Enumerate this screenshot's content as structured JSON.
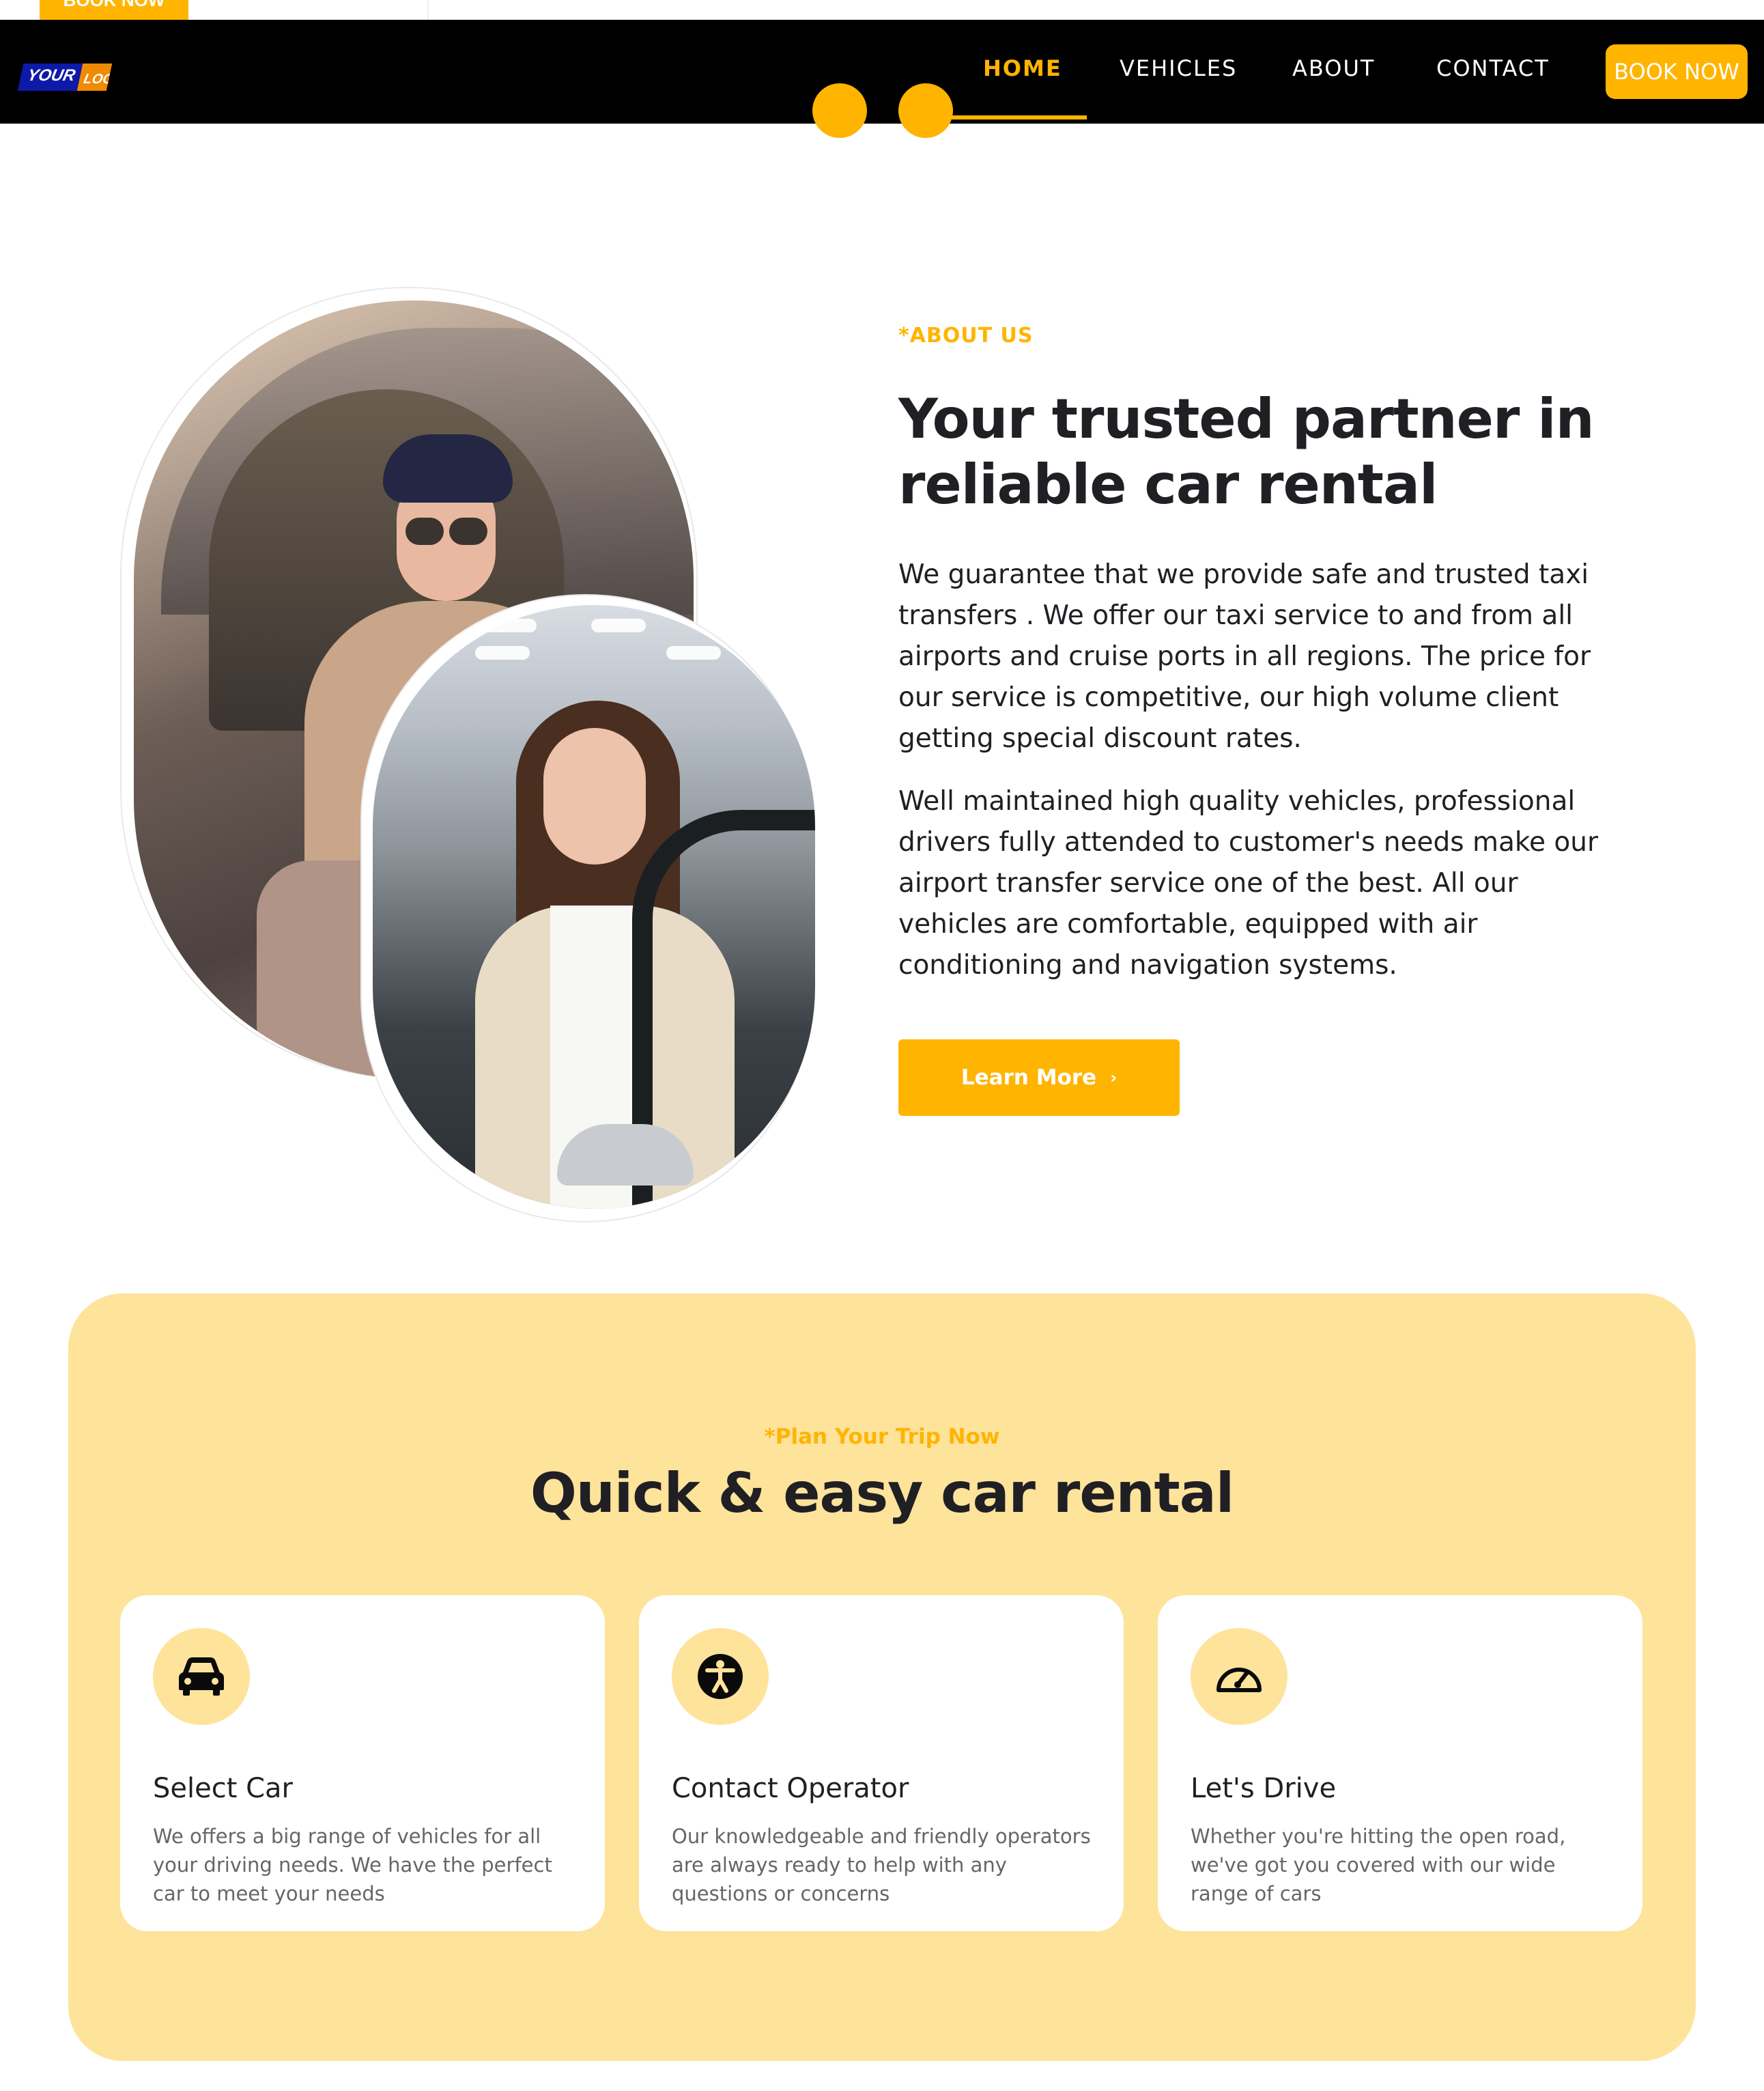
{
  "top_strip": {
    "book_label": "BOOK NOW"
  },
  "header": {
    "logo": {
      "part1": "YOUR",
      "part2": "LOGO"
    },
    "nav": [
      {
        "label": "HOME",
        "active": true
      },
      {
        "label": "VEHICLES",
        "active": false
      },
      {
        "label": "ABOUT",
        "active": false
      },
      {
        "label": "CONTACT",
        "active": false
      }
    ],
    "book_label": "BOOK NOW"
  },
  "about": {
    "kicker": "*ABOUT US",
    "title": "Your trusted partner in reliable car rental",
    "paragraph1": "We guarantee that we provide safe and trusted taxi transfers . We offer our taxi service to and from all airports and cruise ports in all regions. The price for our service is competitive, our high volume client getting special discount rates.",
    "paragraph2": "Well maintained high quality vehicles, professional drivers fully attended to customer's needs make our airport transfer service one of the best. All our vehicles are comfortable, equipped with air conditioning and navigation systems.",
    "button_label": "Learn More",
    "button_icon": "chevron-right-icon"
  },
  "plan": {
    "kicker": "*Plan Your Trip Now",
    "title": "Quick & easy car rental",
    "cards": [
      {
        "icon": "car-icon",
        "title": "Select Car",
        "text": "We offers a big range of vehicles for all your driving needs. We have the perfect car to meet your needs"
      },
      {
        "icon": "accessibility-icon",
        "title": "Contact Operator",
        "text": "Our knowledgeable and friendly operators are always ready to help with any questions or concerns"
      },
      {
        "icon": "speedometer-icon",
        "title": "Let's Drive",
        "text": "Whether you're hitting the open road, we've got you covered with our wide range of cars"
      }
    ]
  },
  "colors": {
    "accent": "#ffb400",
    "header_bg": "#000000",
    "plan_bg": "#fee39b",
    "text": "#1f1f24",
    "muted_text": "#666666"
  }
}
